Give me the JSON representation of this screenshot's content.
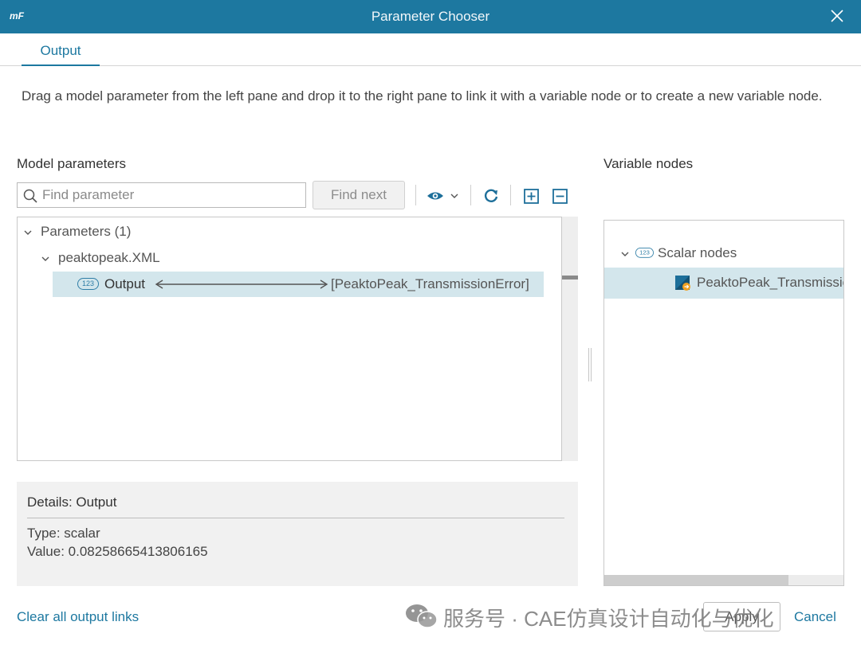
{
  "window": {
    "logo_text": "mF",
    "title": "Parameter Chooser"
  },
  "tabs": [
    {
      "label": "Output",
      "active": true
    }
  ],
  "instructions": "Drag a model parameter from the left pane and drop it to the right pane to link it with a variable node or to create a new variable node.",
  "model_parameters": {
    "heading": "Model parameters",
    "search": {
      "placeholder": "Find parameter",
      "value": ""
    },
    "find_next_label": "Find next",
    "tree": {
      "root_label": "Parameters (1)",
      "file_label": "peaktopeak.XML",
      "item": {
        "badge": "123",
        "label": "Output",
        "link_target": "[PeaktoPeak_TransmissionError]"
      }
    }
  },
  "details": {
    "heading": "Details: Output",
    "type_line": "Type: scalar",
    "value_line": "Value: 0.08258665413806165"
  },
  "variable_nodes": {
    "heading": "Variable nodes",
    "group": {
      "badge": "123",
      "label": "Scalar nodes"
    },
    "node_label": "PeaktoPeak_TransmissionError"
  },
  "footer": {
    "clear_link": "Clear all output links",
    "apply_label": "Apply",
    "cancel_label": "Cancel"
  },
  "watermark": {
    "text": "服务号 · CAE仿真设计自动化与优化"
  },
  "colors": {
    "titlebar": "#1d78a0",
    "accent": "#1d78a0",
    "selection": "#d3e6ec",
    "node_icon_blue": "#1d6f9a",
    "node_icon_orange": "#f0a020"
  },
  "icons": {
    "close": "close-icon",
    "search": "search-icon",
    "visibility": "eye-icon",
    "refresh": "refresh-icon",
    "expand_all": "expand-all-icon",
    "collapse_all": "collapse-all-icon"
  }
}
